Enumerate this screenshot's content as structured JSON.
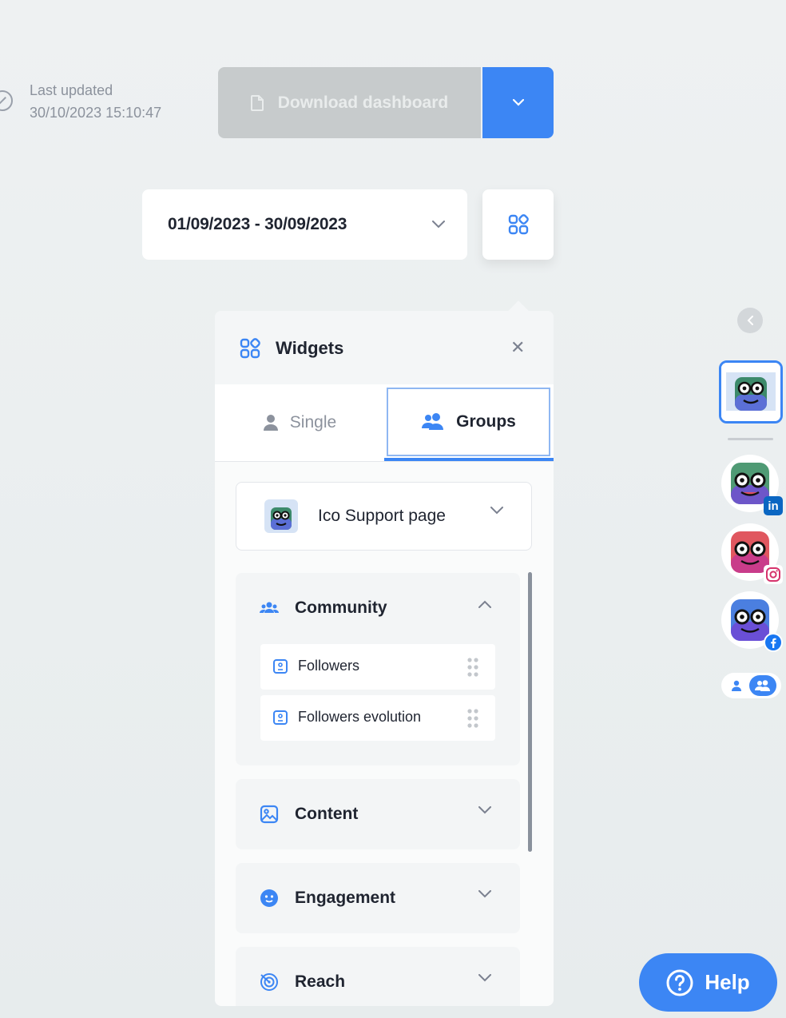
{
  "last_updated": {
    "label": "Last updated",
    "value": "30/10/2023 15:10:47"
  },
  "download": {
    "label": "Download dashboard",
    "icon": "document-icon",
    "dropdown_icon": "chevron-down-icon"
  },
  "date_range": {
    "value": "01/09/2023 - 30/09/2023"
  },
  "widgets_panel": {
    "title": "Widgets",
    "tabs": [
      {
        "label": "Single",
        "icon": "user-icon",
        "selected": false
      },
      {
        "label": "Groups",
        "icon": "users-icon",
        "selected": true
      }
    ],
    "page_selector": {
      "value": "Ico Support page"
    },
    "sections": [
      {
        "label": "Community",
        "icon": "community-icon",
        "expanded": true,
        "widgets": [
          {
            "label": "Followers"
          },
          {
            "label": "Followers evolution"
          }
        ]
      },
      {
        "label": "Content",
        "icon": "image-icon",
        "expanded": false
      },
      {
        "label": "Engagement",
        "icon": "emoji-icon",
        "expanded": false
      },
      {
        "label": "Reach",
        "icon": "reach-icon",
        "expanded": false
      }
    ]
  },
  "right_rail": {
    "networks": [
      "linkedin",
      "instagram",
      "facebook"
    ]
  },
  "help": {
    "label": "Help"
  },
  "colors": {
    "accent": "#3c86f4",
    "disabled": "#c7cbcc",
    "text": "#1f2430",
    "muted": "#8c929d"
  }
}
